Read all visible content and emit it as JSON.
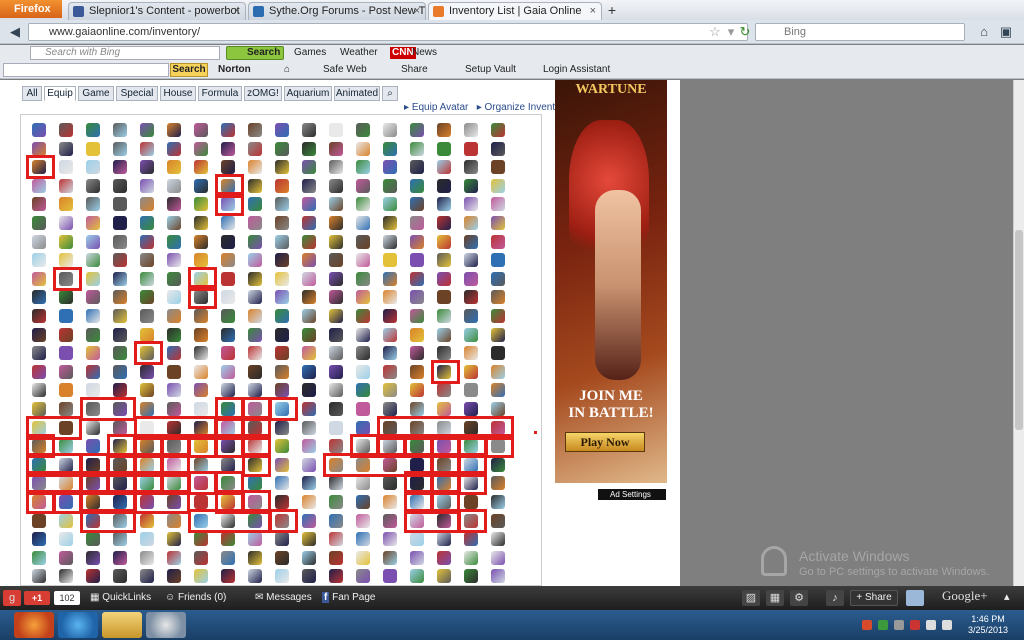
{
  "browser": {
    "menu_button": "Firefox",
    "tabs": [
      {
        "title": "Slepnior1's Content - powerbot",
        "active": false
      },
      {
        "title": "Sythe.Org Forums - Post New Thread",
        "active": false
      },
      {
        "title": "Inventory List | Gaia Online",
        "active": true
      }
    ],
    "new_tab_symbol": "+",
    "url": "www.gaiaonline.com/inventory/",
    "search_placeholder": "Bing"
  },
  "toolbar_bing": {
    "input_placeholder": "Search with Bing",
    "search_label": "Search",
    "items": [
      "Games",
      "Weather",
      "CNN",
      "News"
    ]
  },
  "toolbar_norton": {
    "search_label": "Search",
    "brand": "Norton",
    "items": [
      "Safe Web",
      "Share",
      "Setup Vault",
      "Login Assistant"
    ]
  },
  "inventory": {
    "tabs": [
      "All",
      "Equip",
      "Game",
      "Special",
      "House",
      "Formula",
      "zOMG!",
      "Aquarium",
      "Animated"
    ],
    "active_tab": "Equip",
    "links": [
      "Equip Avatar",
      "Organize Inventory"
    ],
    "highlighted_count": 68
  },
  "ad": {
    "logo": "WARTUNE",
    "headline_1": "JOIN ME",
    "headline_2": "IN BATTLE!",
    "button": "Play Now",
    "settings": "Ad Settings"
  },
  "watermark": {
    "title": "Activate Windows",
    "subtitle": "Go to PC settings to activate Windows."
  },
  "gaia_bar": {
    "plus_one": "+1",
    "count": "102",
    "items": [
      "QuickLinks",
      "Friends (0)",
      "Messages",
      "Fan Page"
    ],
    "share": "Share",
    "google_plus": "Google+"
  },
  "taskbar": {
    "time": "1:46 PM",
    "date": "3/25/2013"
  },
  "colors": {
    "highlight": "#e21b1b",
    "gaia_bar": "#2a2a2a",
    "taskbar": "#2b5d8f"
  }
}
